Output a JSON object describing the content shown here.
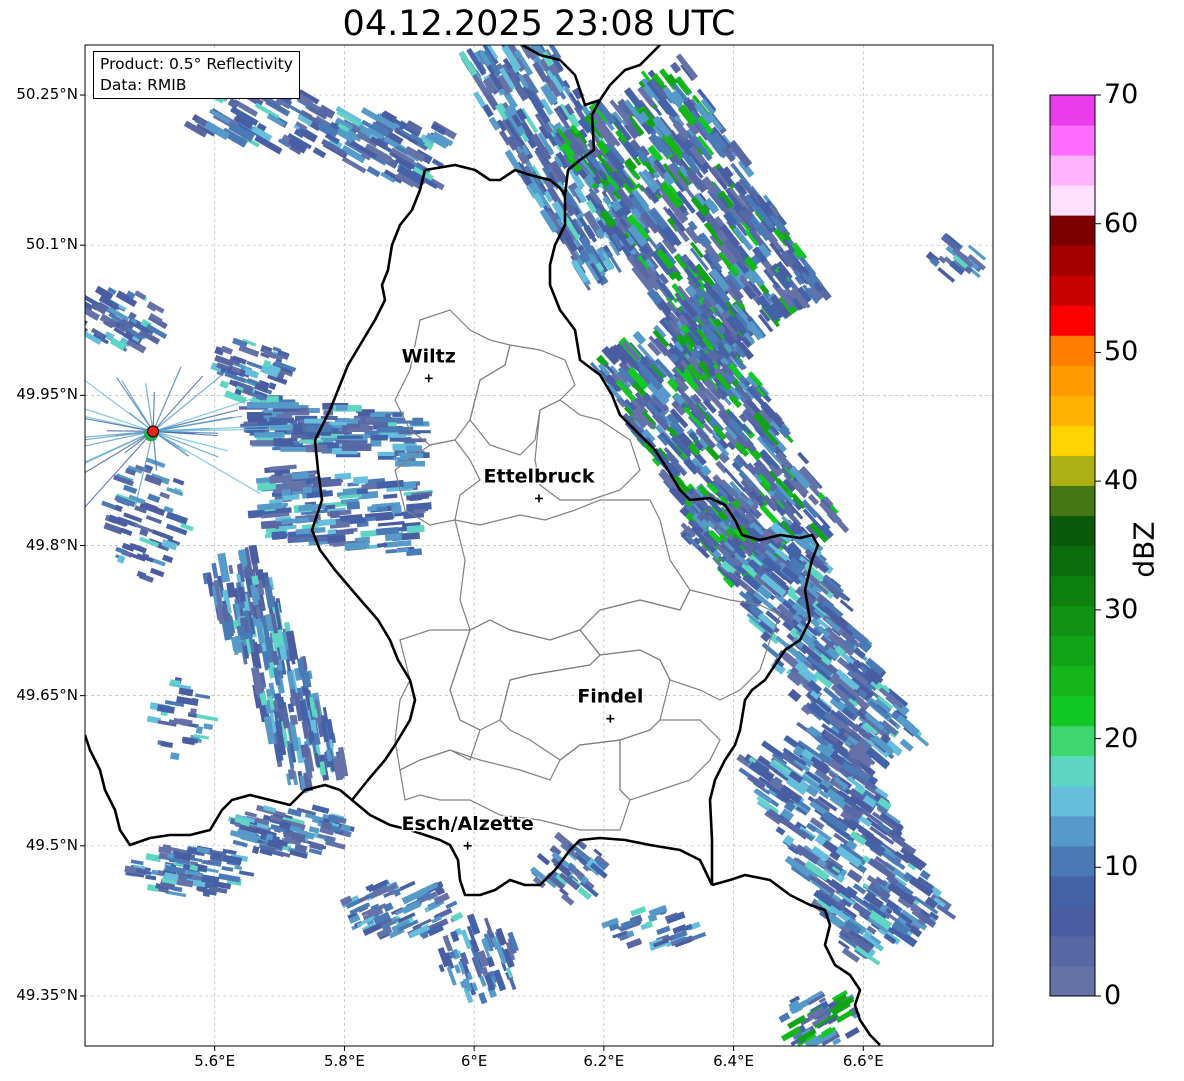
{
  "title": "04.12.2025 23:08 UTC",
  "info": {
    "product": "Product: 0.5° Reflectivity",
    "data_source": "Data: RMIB"
  },
  "latitude_labels": [
    "50.25°N",
    "50.1°N",
    "49.95°N",
    "49.8°N",
    "49.65°N",
    "49.5°N",
    "49.35°N"
  ],
  "longitude_labels": [
    "5.6°E",
    "5.8°E",
    "6°E",
    "6.2°E",
    "6.4°E",
    "6.6°E"
  ],
  "cities": [
    {
      "name": "Wiltz",
      "lon": 5.93,
      "lat": 49.967
    },
    {
      "name": "Ettelbruck",
      "lon": 6.1,
      "lat": 49.847
    },
    {
      "name": "Findel",
      "lon": 6.21,
      "lat": 49.627
    },
    {
      "name": "Esch/Alzette",
      "lon": 5.99,
      "lat": 49.5
    }
  ],
  "radar_site": {
    "lon": 5.505,
    "lat": 49.914
  },
  "map_extent": {
    "lon": [
      5.4,
      6.8
    ],
    "lat": [
      49.3,
      50.3
    ]
  },
  "colorbar": {
    "label": "dBZ",
    "ticks": [
      "0",
      "10",
      "20",
      "30",
      "40",
      "50",
      "60",
      "70"
    ],
    "range": [
      0,
      70
    ],
    "step": 2.5,
    "colors": [
      "#6572a8",
      "#5868a4",
      "#4a5da0",
      "#4462a8",
      "#4a7ab6",
      "#559ac8",
      "#64bedc",
      "#5fd6c4",
      "#3ed66e",
      "#12c824",
      "#14b61a",
      "#12a418",
      "#109212",
      "#0d800e",
      "#0a6d0b",
      "#0a5a0a",
      "#457812",
      "#acb014",
      "#ffd400",
      "#ffb200",
      "#ff9a00",
      "#ff7e00",
      "#ff0000",
      "#c80000",
      "#a50000",
      "#7d0000",
      "#ffe0ff",
      "#ffb4ff",
      "#ff6cff",
      "#eb3ceb"
    ]
  },
  "colors": {
    "border": "#000000",
    "canton_lines": "#808080",
    "gridlines": "#b8b8b8",
    "radar_marker": "#e8231e"
  }
}
